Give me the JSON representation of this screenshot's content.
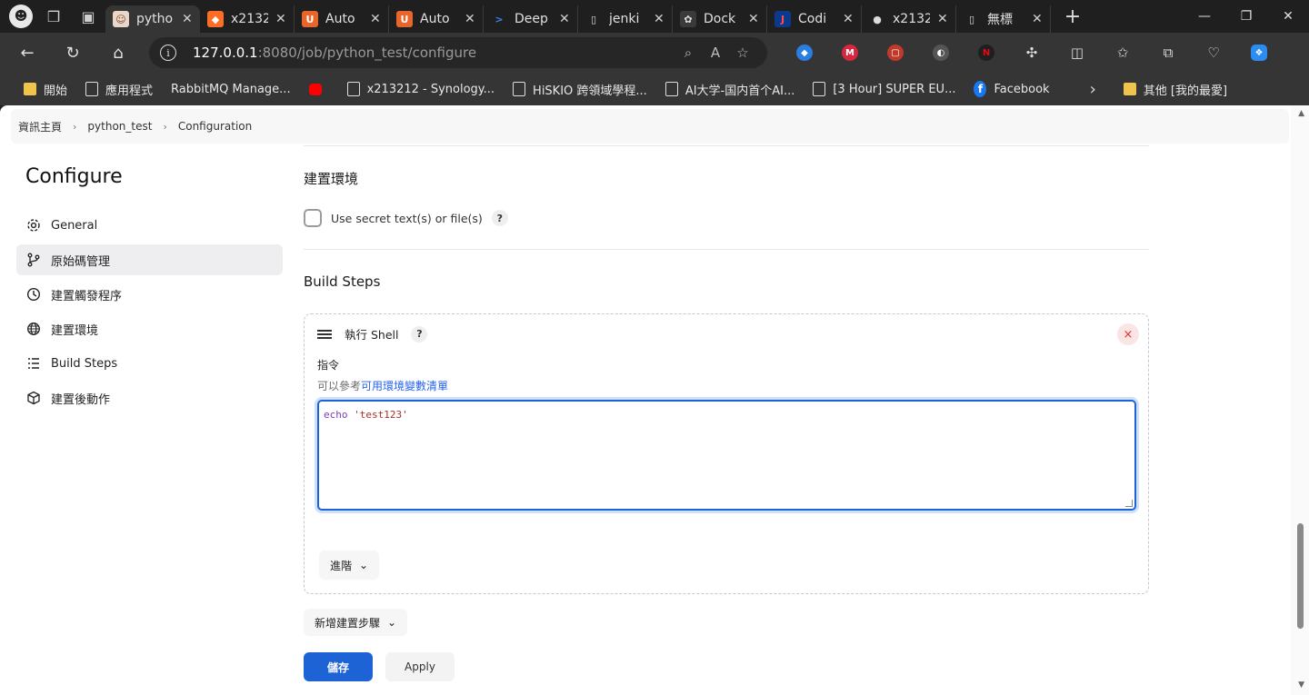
{
  "browser": {
    "tabs": [
      {
        "title": "pytho",
        "icon_bg": "#e9d6c8",
        "icon_fg": "#7a4a2a",
        "icon_glyph": "☺",
        "active": true
      },
      {
        "title": "x2132",
        "icon_bg": "#fc6d26",
        "icon_fg": "#ffffff",
        "icon_glyph": "◆",
        "active": false
      },
      {
        "title": "Auto",
        "icon_bg": "#e8652b",
        "icon_fg": "#ffffff",
        "icon_glyph": "U",
        "active": false
      },
      {
        "title": "Auto",
        "icon_bg": "#e8652b",
        "icon_fg": "#ffffff",
        "icon_glyph": "U",
        "active": false
      },
      {
        "title": "Deep",
        "icon_bg": "#1f1f1f",
        "icon_fg": "#3b82f6",
        "icon_glyph": ">",
        "active": false
      },
      {
        "title": "jenki",
        "icon_bg": "#1f1f1f",
        "icon_fg": "#dddddd",
        "icon_glyph": "▯",
        "active": false
      },
      {
        "title": "Dock",
        "icon_bg": "#3a3a3a",
        "icon_fg": "#dddddd",
        "icon_glyph": "✿",
        "active": false
      },
      {
        "title": "Codi",
        "icon_bg": "#0b3a8c",
        "icon_fg": "#ff4d4d",
        "icon_glyph": "J",
        "active": false
      },
      {
        "title": "x2132",
        "icon_bg": "#1f1f1f",
        "icon_fg": "#dddddd",
        "icon_glyph": "●",
        "active": false
      },
      {
        "title": "無標",
        "icon_bg": "#1f1f1f",
        "icon_fg": "#dddddd",
        "icon_glyph": "▯",
        "active": false
      }
    ],
    "url_host": "127.0.0.1",
    "url_rest": ":8080/job/python_test/configure",
    "bookmarks": [
      {
        "label": "開始",
        "type": "folder"
      },
      {
        "label": "應用程式",
        "type": "page"
      },
      {
        "label": "RabbitMQ Manage...",
        "type": "none"
      },
      {
        "label": "",
        "type": "yt"
      },
      {
        "label": "x213212 - Synology...",
        "type": "page"
      },
      {
        "label": "HiSKIO 跨領域學程...",
        "type": "page"
      },
      {
        "label": "AI大学-国内首个AI...",
        "type": "page"
      },
      {
        "label": "[3 Hour] SUPER EU...",
        "type": "page"
      },
      {
        "label": "Facebook",
        "type": "fb"
      }
    ],
    "other_bookmarks": "其他 [我的最愛]"
  },
  "breadcrumb": {
    "items": [
      "資訊主頁",
      "python_test",
      "Configuration"
    ]
  },
  "sidebar": {
    "title": "Configure",
    "items": [
      {
        "label": "General",
        "icon": "gear-icon",
        "active": false
      },
      {
        "label": "原始碼管理",
        "icon": "branch-icon",
        "active": true
      },
      {
        "label": "建置觸發程序",
        "icon": "clock-icon",
        "active": false
      },
      {
        "label": "建置環境",
        "icon": "globe-icon",
        "active": false
      },
      {
        "label": "Build Steps",
        "icon": "list-icon",
        "active": false
      },
      {
        "label": "建置後動作",
        "icon": "cube-icon",
        "active": false
      }
    ]
  },
  "build_env": {
    "title": "建置環境",
    "secret_label": "Use secret text(s) or file(s)"
  },
  "build_steps": {
    "title": "Build Steps",
    "step_title": "執行 Shell",
    "command_label": "指令",
    "desc_prefix": "可以參考",
    "desc_link": "可用環境變數清單",
    "command_kw": "echo",
    "command_str": "'test123'",
    "advanced_label": "進階",
    "add_step_label": "新增建置步驟"
  },
  "actions": {
    "save": "儲存",
    "apply": "Apply"
  },
  "help_glyph": "?",
  "close_glyph": "×",
  "chevron_glyph": "⌄"
}
